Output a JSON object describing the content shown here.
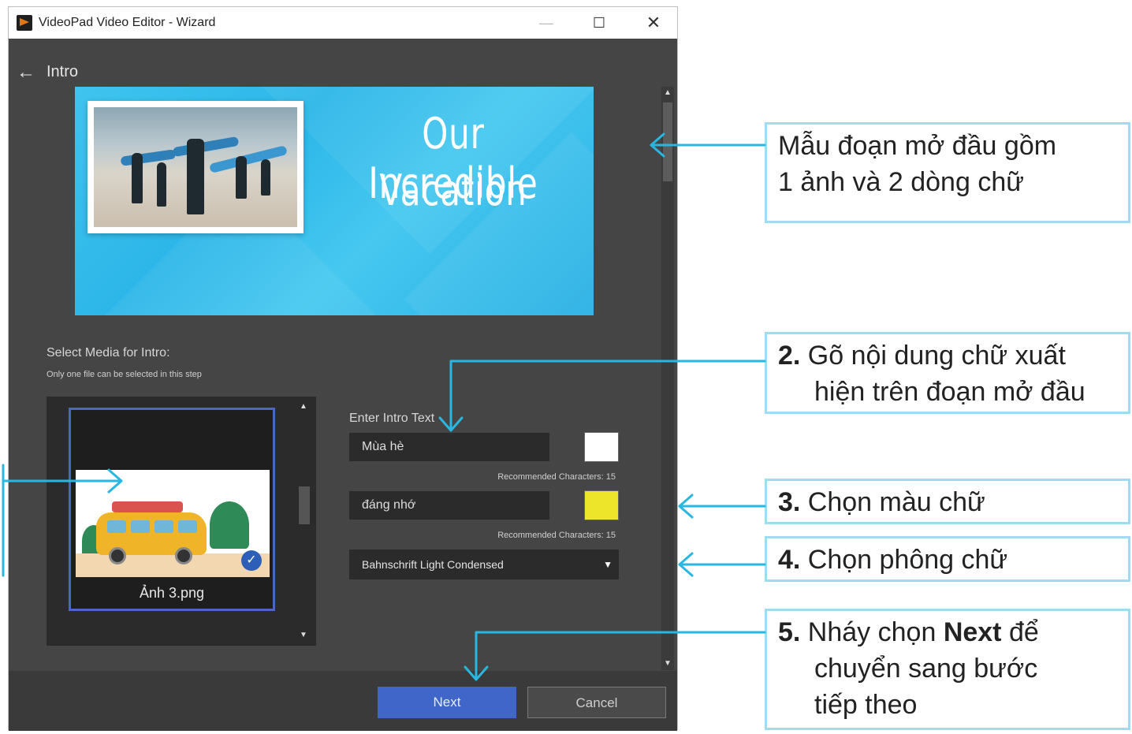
{
  "window": {
    "title": "VideoPad Video Editor - Wizard",
    "minimize_symbol": "—",
    "maximize_symbol": "☐",
    "close_symbol": "✕"
  },
  "header": {
    "back_symbol": "←",
    "title": "Intro"
  },
  "preview": {
    "line1": "Our Incredible",
    "line2": "Vacation"
  },
  "media": {
    "label": "Select Media for Intro:",
    "note": "Only one file can be selected in this step",
    "file_name": "Ảnh 3.png",
    "check_symbol": "✓"
  },
  "intro_text": {
    "label": "Enter Intro Text",
    "line1_value": "Mùa hè",
    "line2_value": "đáng nhớ",
    "recommended1": "Recommended Characters: 15",
    "recommended2": "Recommended Characters: 15",
    "color1": "#ffffff",
    "color2": "#ede52a",
    "font": "Bahnschrift Light Condensed"
  },
  "footer": {
    "next_label": "Next",
    "cancel_label": "Cancel"
  },
  "annotations": {
    "c1_line1": "Mẫu đoạn mở đầu gồm",
    "c1_line2": "1 ảnh và 2 dòng chữ",
    "c2_num": "2.",
    "c2_line1": " Gõ nội dung chữ xuất",
    "c2_line2": "hiện trên đoạn mở đầu",
    "c3_num": "3.",
    "c3_text": " Chọn màu chữ",
    "c4_num": "4.",
    "c4_text": " Chọn phông chữ",
    "c5_num": "5.",
    "c5_pre": " Nháy chọn ",
    "c5_bold": "Next",
    "c5_post": " để",
    "c5_line2": "chuyển sang bước",
    "c5_line3": "tiếp theo"
  },
  "colors": {
    "accent": "#3f66c8",
    "arrow": "#29b6e0",
    "callout_border": "#9fdcf2",
    "window_bg": "#454545"
  }
}
